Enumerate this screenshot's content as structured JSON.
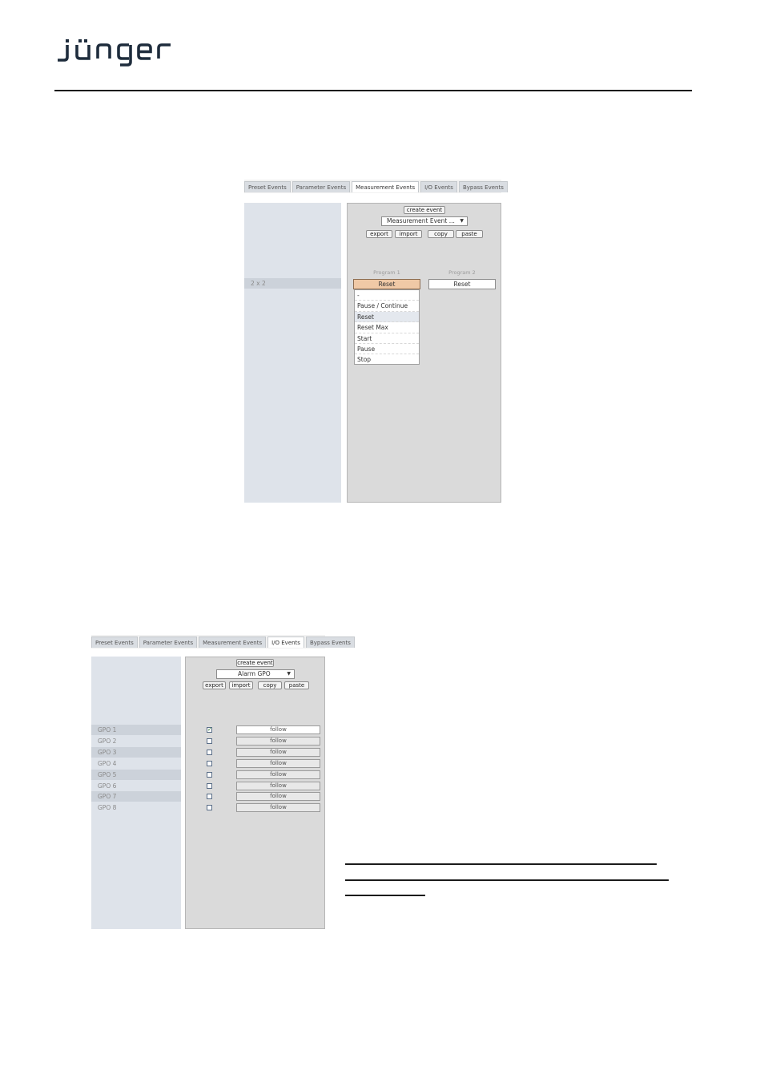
{
  "brand": {
    "logo_text": "jünger"
  },
  "panel1": {
    "tabs": [
      {
        "label": "Preset Events",
        "active": false
      },
      {
        "label": "Parameter Events",
        "active": false
      },
      {
        "label": "Measurement Events",
        "active": true
      },
      {
        "label": "I/O Events",
        "active": false
      },
      {
        "label": "Bypass Events",
        "active": false
      }
    ],
    "create_button": "create event",
    "event_select": "Measurement Event ...",
    "actions": {
      "export": "export",
      "import": "import",
      "copy": "copy",
      "paste": "paste"
    },
    "columns": [
      "Program 1",
      "Program 2"
    ],
    "row_label": "2 x 2",
    "program1_value": "Reset",
    "program2_value": "Reset",
    "dropdown_options": [
      "-",
      "Pause / Continue",
      "Reset",
      "Reset Max",
      "Start",
      "Pause",
      "Stop"
    ],
    "dropdown_highlighted": "Reset",
    "colors": {
      "selected_cell": "#f0c9a6",
      "left_column": "#dee3ea",
      "right_column": "#dadada"
    }
  },
  "panel2": {
    "tabs": [
      {
        "label": "Preset Events",
        "active": false
      },
      {
        "label": "Parameter Events",
        "active": false
      },
      {
        "label": "Measurement Events",
        "active": false
      },
      {
        "label": "I/O Events",
        "active": true
      },
      {
        "label": "Bypass Events",
        "active": false
      }
    ],
    "create_button": "create event",
    "event_select": "Alarm GPO",
    "actions": {
      "export": "export",
      "import": "import",
      "copy": "copy",
      "paste": "paste"
    },
    "rows": [
      {
        "label": "GPO 1",
        "checked": true,
        "mode": "follow"
      },
      {
        "label": "GPO 2",
        "checked": false,
        "mode": "follow"
      },
      {
        "label": "GPO 3",
        "checked": false,
        "mode": "follow"
      },
      {
        "label": "GPO 4",
        "checked": false,
        "mode": "follow"
      },
      {
        "label": "GPO 5",
        "checked": false,
        "mode": "follow"
      },
      {
        "label": "GPO 6",
        "checked": false,
        "mode": "follow"
      },
      {
        "label": "GPO 7",
        "checked": false,
        "mode": "follow"
      },
      {
        "label": "GPO 8",
        "checked": false,
        "mode": "follow"
      }
    ]
  }
}
